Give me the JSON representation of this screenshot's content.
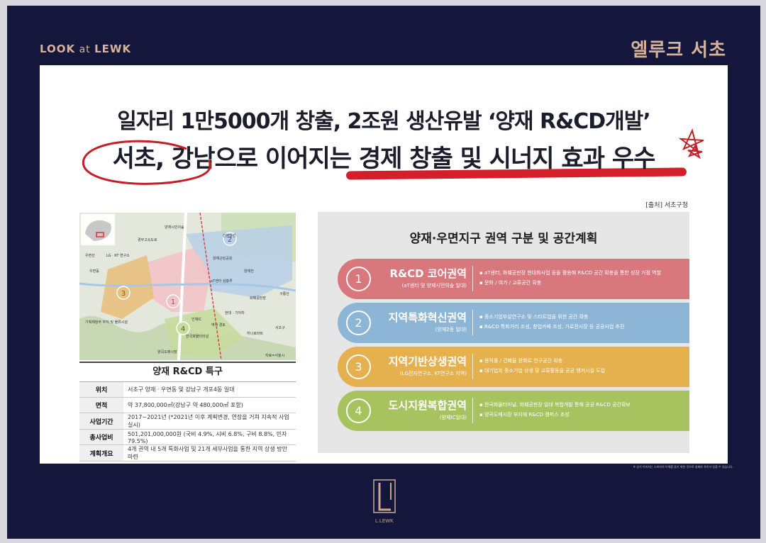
{
  "header": {
    "left_bold": "LOOK",
    "left_mid": " at ",
    "left_end": "LEWK",
    "right": "엘루크 서초"
  },
  "headline": {
    "line1_a": "일자리 1만5000개 창출, 2조원 생산유발 ",
    "line1_b": "‘양재 R&CD개발’",
    "line2": "서초, 강남으로 이어지는 경제 창출 및 시너지 효과 우수"
  },
  "source": "[출처] 서초구청",
  "map": {
    "labels": [
      "양재시민의숲",
      "LG · KT 연구소",
      "양재근린공원",
      "aT센터 삼흥루",
      "화훼공판장",
      "현대 · 기아차",
      "인재IC",
      "역사 경토",
      "한국화물터미널",
      "하나로마트",
      "양곡도매시장",
      "기획재정부 부지 및 물류시설",
      "우면산",
      "우면동",
      "신분당선",
      "경부고속도로",
      "구룡산",
      "양재천",
      "서초구"
    ],
    "credits": "자료=서울시",
    "zone_numbers": [
      "1",
      "2",
      "3",
      "4"
    ]
  },
  "rd_table": {
    "title": "양재 R&CD 특구",
    "rows": [
      {
        "key": "위치",
        "value": "서초구 양재 · 우면동 및 강남구 개포4동 일대"
      },
      {
        "key": "면적",
        "value": "약 37,800,000㎡(강남구 약 480,000㎡ 포함)"
      },
      {
        "key": "사업기간",
        "value": "2017~2021년 (*2021년 이후 계획변경, 연장을 거쳐 지속적 사업 실시)"
      },
      {
        "key": "총사업비",
        "value": "501,201,000,000원 (국비 4.9%, 시비 6.8%, 구비 8.8%, 민자 79.5%)"
      },
      {
        "key": "계획개요",
        "value": "4개 권역 내 5개 특화사업 및 21개 세부사업을 통한 지역 상생 방안 마련"
      }
    ]
  },
  "zones_panel": {
    "title": "양재·우면지구 권역 구분 및 공간계획",
    "zones": [
      {
        "num": "1",
        "name": "R&CD 코어권역",
        "sub": "(aT센터 및 양재시민의숲 일대)",
        "color": "#d8777c",
        "items": [
          "aT센터, 화훼공판장 현대화사업 등을 활용해 R&CD 공간 확충을 통한 성장 거점 역할",
          "문화 / 여가 / 교류공간 확충"
        ]
      },
      {
        "num": "2",
        "name": "지역특화혁신권역",
        "sub": "(양재2동 일대)",
        "color": "#8db6d6",
        "items": [
          "중소기업부설연구소 및 스타트업을 위한 공간 확충",
          "R&CD 특화거리 조성, 창업카페 조성, 가로전시장 등 공공사업 추진"
        ]
      },
      {
        "num": "3",
        "name": "지역기반상생권역",
        "sub": "(LG전자연구소, KT연구소 지역)",
        "color": "#e5b04e",
        "items": [
          "용적률 / 건폐율 완화로 연구공간 확충",
          "대기업과 중소기업 상생 및 교류활동을 공공 앵커시설 도입"
        ]
      },
      {
        "num": "4",
        "name": "도시지원복합권역",
        "sub": "(양재IC일대)",
        "color": "#a7c35f",
        "items": [
          "한국화물터미널, 화훼공판장 일대 복합개발 통해 공공 R&CD 공간확보",
          "양곡도매시장 부지에 R&CD 캠퍼스 조성"
        ]
      }
    ]
  },
  "footnote": "※ 상기 이미지는 소비자의 이해를 돕기 위한 것으로 실제와 차이가 있을 수 있습니다.",
  "logo": {
    "text": "L.LEWK"
  }
}
